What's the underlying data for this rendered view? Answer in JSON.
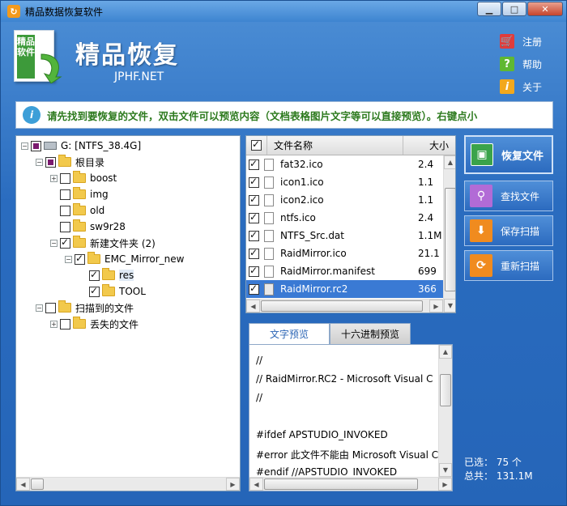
{
  "window": {
    "title": "精品数据恢复软件",
    "controls": [
      "minimize",
      "maximize",
      "close"
    ]
  },
  "brand": {
    "title": "精品恢复",
    "subtitle": "JPHF.NET",
    "logo_text": "精品软件"
  },
  "top_links": [
    {
      "label": "注册",
      "icon": "cart-icon",
      "color": "#e03c3c"
    },
    {
      "label": "帮助",
      "icon": "question-icon",
      "color": "#5fb832"
    },
    {
      "label": "关于",
      "icon": "info-icon",
      "color": "#f2a81d"
    }
  ],
  "info_bar": {
    "text": "请先找到要恢复的文件，双击文件可以预览内容（文档表格图片文字等可以直接预览）。右键点小"
  },
  "tree": {
    "drive": {
      "label": "G:  [NTFS_38.4G]",
      "state": "partial"
    },
    "root": {
      "label": "根目录",
      "state": "partial"
    },
    "boost": {
      "label": "boost",
      "state": "unchecked"
    },
    "img": {
      "label": "img",
      "state": "unchecked"
    },
    "old": {
      "label": "old",
      "state": "unchecked"
    },
    "sw9r28": {
      "label": "sw9r28",
      "state": "unchecked"
    },
    "new_folder": {
      "label": "新建文件夹 (2)",
      "state": "checked"
    },
    "emc": {
      "label": "EMC_Mirror_new",
      "state": "checked"
    },
    "res": {
      "label": "res",
      "state": "checked"
    },
    "tool": {
      "label": "TOOL",
      "state": "checked"
    },
    "scanned": {
      "label": "扫描到的文件",
      "state": "unchecked"
    },
    "lost": {
      "label": "丢失的文件",
      "state": "unchecked"
    }
  },
  "file_list": {
    "columns": {
      "name": "文件名称",
      "size": "大小"
    },
    "rows": [
      {
        "name": "fat32.ico",
        "size": "2.4",
        "checked": true,
        "selected": false
      },
      {
        "name": "icon1.ico",
        "size": "1.1",
        "checked": true,
        "selected": false
      },
      {
        "name": "icon2.ico",
        "size": "1.1",
        "checked": true,
        "selected": false
      },
      {
        "name": "ntfs.ico",
        "size": "2.4",
        "checked": true,
        "selected": false
      },
      {
        "name": "NTFS_Src.dat",
        "size": "1.1M",
        "checked": true,
        "selected": false
      },
      {
        "name": "RaidMirror.ico",
        "size": "21.1",
        "checked": true,
        "selected": false
      },
      {
        "name": "RaidMirror.manifest",
        "size": "699",
        "checked": true,
        "selected": false
      },
      {
        "name": "RaidMirror.rc2",
        "size": "366",
        "checked": true,
        "selected": true
      }
    ]
  },
  "preview": {
    "tabs": [
      "文字预览",
      "十六进制预览"
    ],
    "lines": [
      "//",
      "// RaidMirror.RC2 - Microsoft Visual C",
      "//",
      "",
      "#ifdef APSTUDIO_INVOKED",
      "#error 此文件不能由 Microsoft Visual C",
      "#endif //APSTUDIO_INVOKED"
    ]
  },
  "actions": {
    "recover": "恢复文件",
    "find": "查找文件",
    "save_scan": "保存扫描",
    "rescan": "重新扫描"
  },
  "stats": {
    "selected_label": "已选：",
    "selected_value": "75 个",
    "total_label": "总共：",
    "total_value": "131.1M"
  }
}
